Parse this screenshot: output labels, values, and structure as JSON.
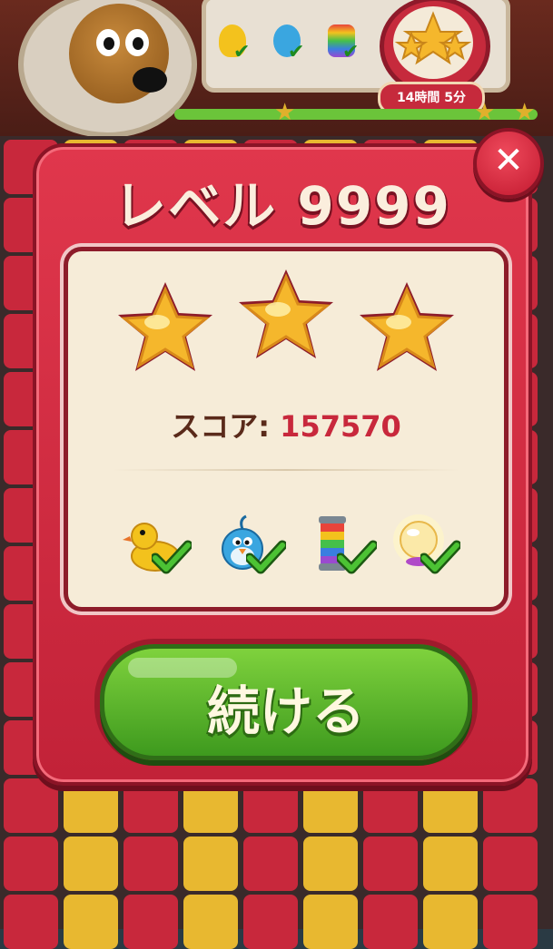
{
  "header": {
    "timer_text": "14時間 5分",
    "goal_icons": [
      "duck-icon",
      "bird-icon",
      "rainbow-canister-icon"
    ]
  },
  "dialog": {
    "title": "レベル 9999",
    "close_icon": "close-icon",
    "stars_earned": 3,
    "stars_total": 3,
    "score_label": "スコア:",
    "score_value": "157570",
    "goals": [
      {
        "icon": "duck-icon",
        "completed": true
      },
      {
        "icon": "bird-icon",
        "completed": true
      },
      {
        "icon": "rainbow-canister-icon",
        "completed": true
      },
      {
        "icon": "disco-ball-icon",
        "completed": true
      }
    ],
    "continue_label": "続ける"
  },
  "colors": {
    "dialog_red": "#d82c42",
    "panel_cream": "#f6ecd8",
    "button_green": "#5cb52c",
    "score_red": "#c8283c",
    "star_gold": "#f5b72c"
  }
}
